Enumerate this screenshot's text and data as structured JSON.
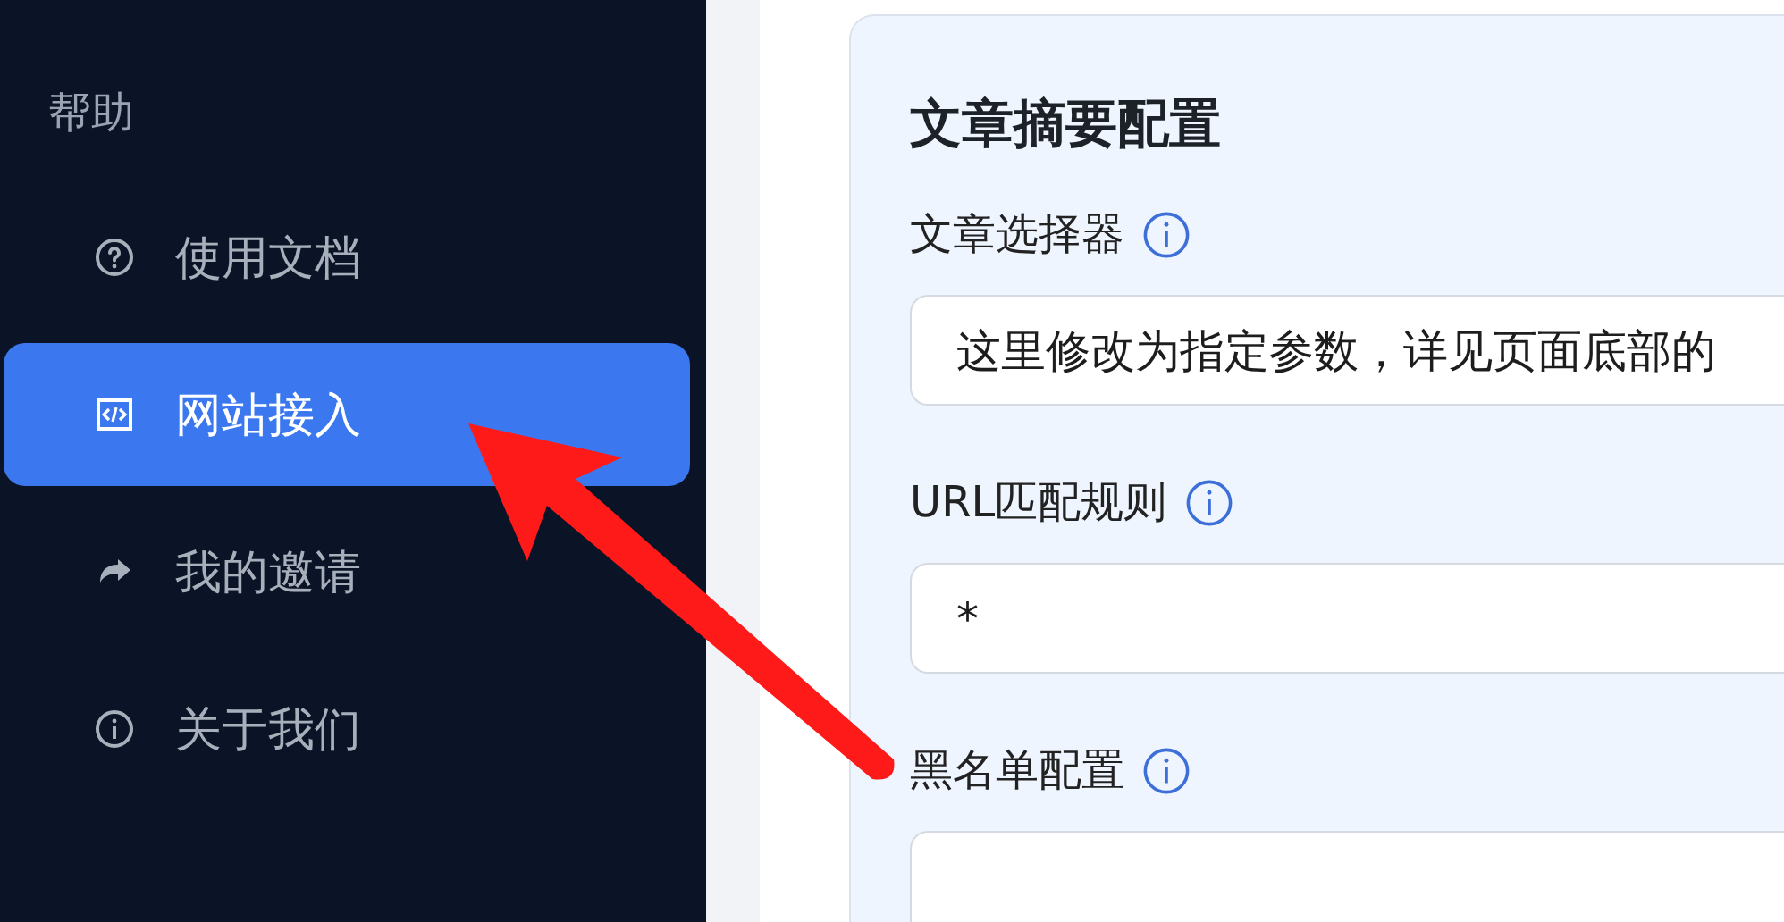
{
  "sidebar": {
    "section_title": "帮助",
    "items": [
      {
        "label": "使用文档",
        "kind": "help",
        "selected": false
      },
      {
        "label": "网站接入",
        "kind": "code",
        "selected": true
      },
      {
        "label": "我的邀请",
        "kind": "share",
        "selected": false
      },
      {
        "label": "关于我们",
        "kind": "info",
        "selected": false
      }
    ]
  },
  "card": {
    "title": "文章摘要配置",
    "fields": [
      {
        "label": "文章选择器",
        "info": true,
        "value": "这里修改为指定参数，详见页面底部的"
      },
      {
        "label": "URL匹配规则",
        "info": true,
        "value": "*"
      },
      {
        "label": "黑名单配置",
        "info": true
      }
    ]
  }
}
